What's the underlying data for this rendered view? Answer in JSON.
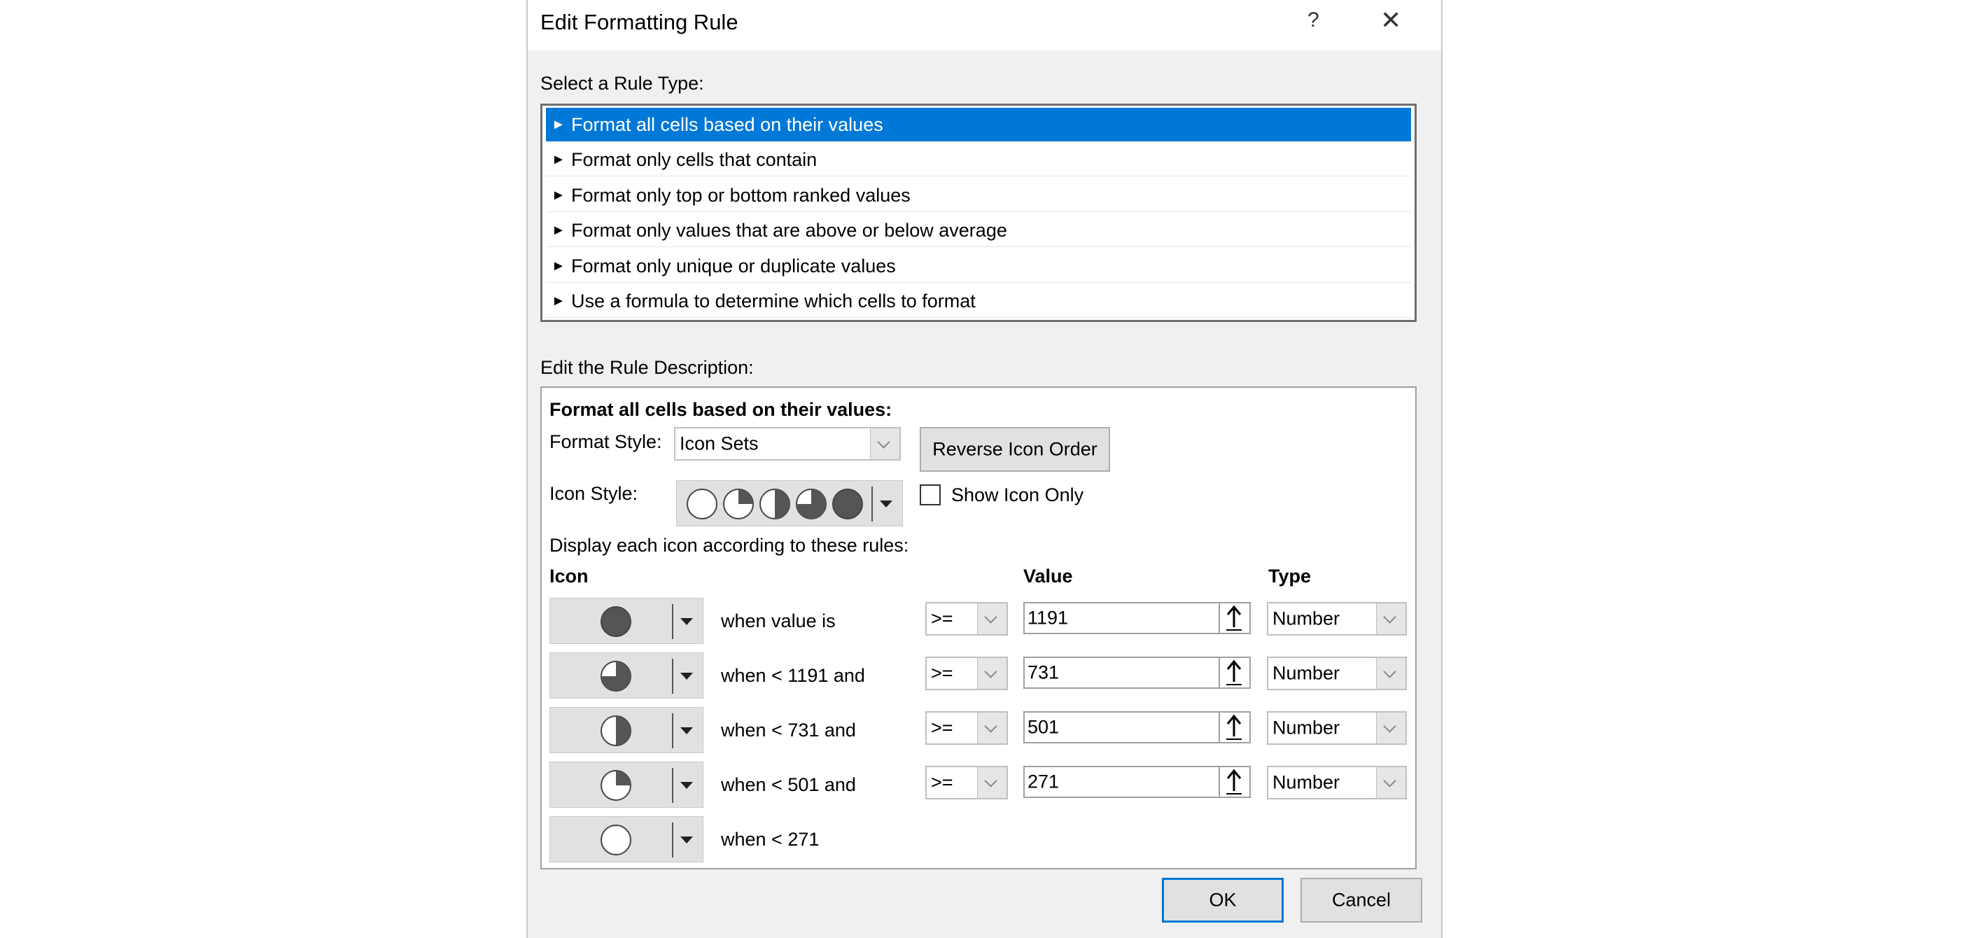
{
  "dialog": {
    "title": "Edit Formatting Rule",
    "help_label": "?",
    "close_label": "✕"
  },
  "rule_type": {
    "label": "Select a Rule Type:",
    "items": [
      {
        "label": "Format all cells based on their values",
        "selected": true
      },
      {
        "label": "Format only cells that contain",
        "selected": false
      },
      {
        "label": "Format only top or bottom ranked values",
        "selected": false
      },
      {
        "label": "Format only values that are above or below average",
        "selected": false
      },
      {
        "label": "Format only unique or duplicate values",
        "selected": false
      },
      {
        "label": "Use a formula to determine which cells to format",
        "selected": false
      }
    ],
    "item_marker": "►"
  },
  "description": {
    "label": "Edit the Rule Description:",
    "heading": "Format all cells based on their values:",
    "format_style_label": "Format Style:",
    "format_style_value": "Icon Sets",
    "reverse_button": "Reverse Icon Order",
    "icon_style_label": "Icon Style:",
    "icon_style_icons": [
      "quarters-0",
      "quarters-1",
      "quarters-2",
      "quarters-3",
      "quarters-4"
    ],
    "show_icon_only_label": "Show Icon Only",
    "show_icon_only_checked": false,
    "display_rules_label": "Display each icon according to these rules:",
    "col_icon": "Icon",
    "col_value": "Value",
    "col_type": "Type",
    "rules": [
      {
        "icon": "quarters-4",
        "condition": "when value is",
        "operator": ">=",
        "value": "1191",
        "type": "Number"
      },
      {
        "icon": "quarters-3",
        "condition": "when < 1191 and",
        "operator": ">=",
        "value": "731",
        "type": "Number"
      },
      {
        "icon": "quarters-2",
        "condition": "when < 731 and",
        "operator": ">=",
        "value": "501",
        "type": "Number"
      },
      {
        "icon": "quarters-1",
        "condition": "when < 501 and",
        "operator": ">=",
        "value": "271",
        "type": "Number"
      },
      {
        "icon": "quarters-0",
        "condition": "when < 271"
      }
    ]
  },
  "buttons": {
    "ok": "OK",
    "cancel": "Cancel"
  },
  "colors": {
    "selection": "#0078d7",
    "icon_fill": "#555555"
  }
}
